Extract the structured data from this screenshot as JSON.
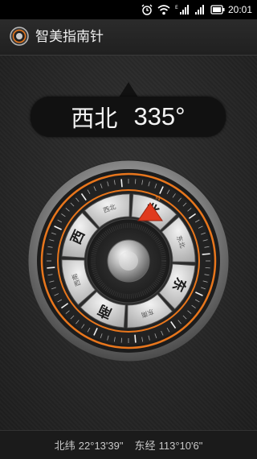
{
  "status_bar": {
    "time": "20:01",
    "icons": [
      "alarm-icon",
      "wifi-icon",
      "signal-icon",
      "signal-icon",
      "battery-icon"
    ]
  },
  "app": {
    "title": "智美指南针",
    "logo_icon": "compass-logo-icon"
  },
  "heading": {
    "direction": "西北",
    "degrees": "335°",
    "degrees_value": 335
  },
  "dial": {
    "major_directions": [
      "北",
      "东",
      "南",
      "西"
    ],
    "minor_directions": [
      "东北",
      "东南",
      "西南",
      "西北"
    ],
    "north_marker": "N",
    "accent_color": "#e8761c",
    "pointer_color": "#e03a1e"
  },
  "footer": {
    "latitude_label": "北纬",
    "latitude_value": "22°13'39\"",
    "longitude_label": "东经",
    "longitude_value": "113°10'6\""
  }
}
